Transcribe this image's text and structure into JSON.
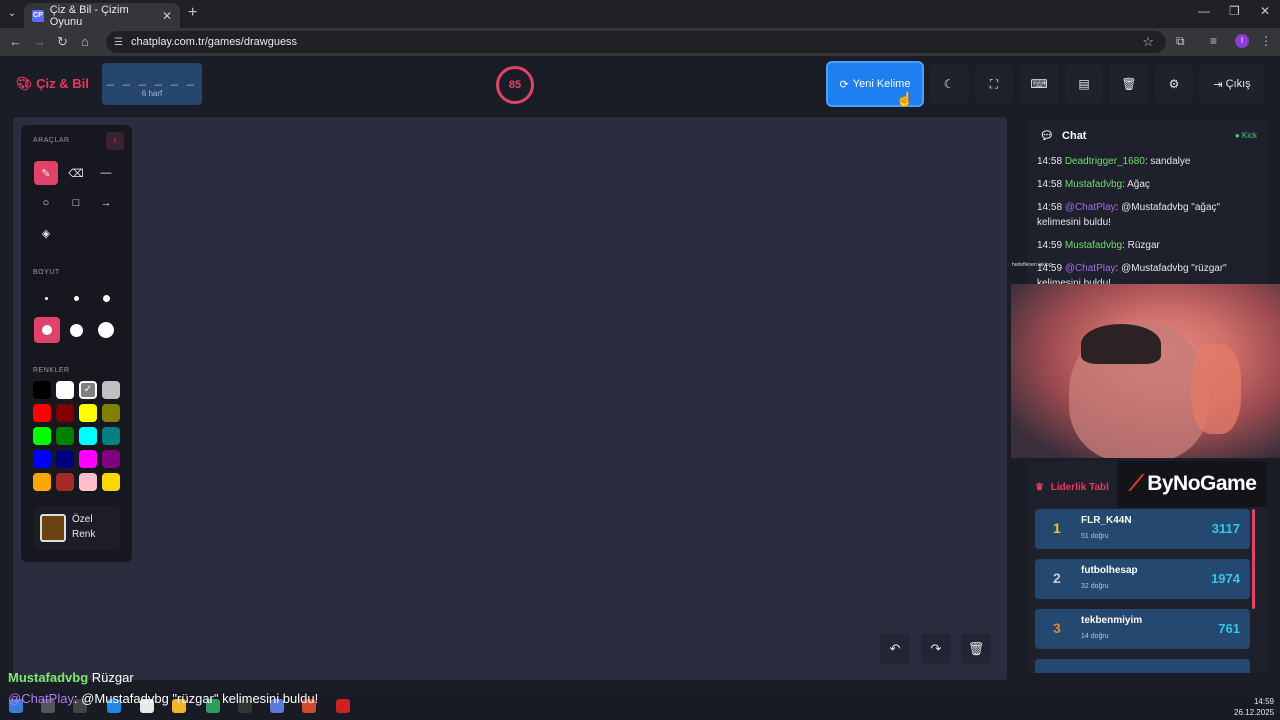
{
  "browser": {
    "tab_title": "Çiz & Bil - Çizim Oyunu",
    "tab_favicon": "CP",
    "url": "chatplay.com.tr/games/drawguess",
    "profile_initial": "I"
  },
  "header": {
    "logo": "Çiz & Bil",
    "word_mask": "_ _ _ _ _ _",
    "word_hint": "6 harf",
    "timer": "85",
    "new_word_label": "Yeni Kelime",
    "exit_label": "Çıkış"
  },
  "tools": {
    "tools_label": "ARAÇLAR",
    "size_label": "BOYUT",
    "colors_label": "RENKLER",
    "custom_color_line1": "Özel",
    "custom_color_line2": "Renk",
    "colors": [
      "#000000",
      "#ffffff",
      "#808080",
      "#c0c0c0",
      "#ff0000",
      "#800000",
      "#ffff00",
      "#808000",
      "#00ff00",
      "#008000",
      "#00ffff",
      "#008080",
      "#0000ff",
      "#000080",
      "#ff00ff",
      "#800080",
      "#ffa500",
      "#a52a2a",
      "#ffc0cb",
      "#ffd700"
    ],
    "custom_color": "#6b4413"
  },
  "chat": {
    "title": "Chat",
    "status": "Kick",
    "messages": [
      {
        "time": "14:58",
        "user": "Deadtrigger_1680",
        "text": ": sandalye"
      },
      {
        "time": "14:58",
        "user": "Mustafadvbg",
        "text": ": Ağaç"
      },
      {
        "time": "14:58",
        "user": "@ChatPlay",
        "text": ": @Mustafadvbg \"ağaç\" kelimesini buldu!"
      },
      {
        "time": "14:59",
        "user": "Mustafadvbg",
        "text": ": Rüzgar"
      },
      {
        "time": "14:59",
        "user": "@ChatPlay",
        "text": ": @Mustafadvbg \"rüzgar\" kelimesini buldu!"
      }
    ]
  },
  "webcam": {
    "label": "hedeflenen takipçi"
  },
  "leaderboard": {
    "title": "Liderlik Tabl",
    "sponsor": "ByNoGame",
    "rows": [
      {
        "rank": "1",
        "name": "FLR_K44N",
        "sub": "51 doğru",
        "score": "3117",
        "rank_color": "#f2c230"
      },
      {
        "rank": "2",
        "name": "futbolhesap",
        "sub": "32 doğru",
        "score": "1974",
        "rank_color": "#c8ccd4"
      },
      {
        "rank": "3",
        "name": "tekbenmiyim",
        "sub": "14 doğru",
        "score": "761",
        "rank_color": "#d98a3c"
      }
    ]
  },
  "overlay": {
    "line1_user": "Mustafadvbg",
    "line1_text": "Rüzgar",
    "line2_user": "@ChatPlay",
    "line2_text": ": @Mustafadvbg \"rüzgar\" kelimesini buldu!"
  },
  "taskbar": {
    "time": "14:59",
    "date": "26.12.2025"
  }
}
